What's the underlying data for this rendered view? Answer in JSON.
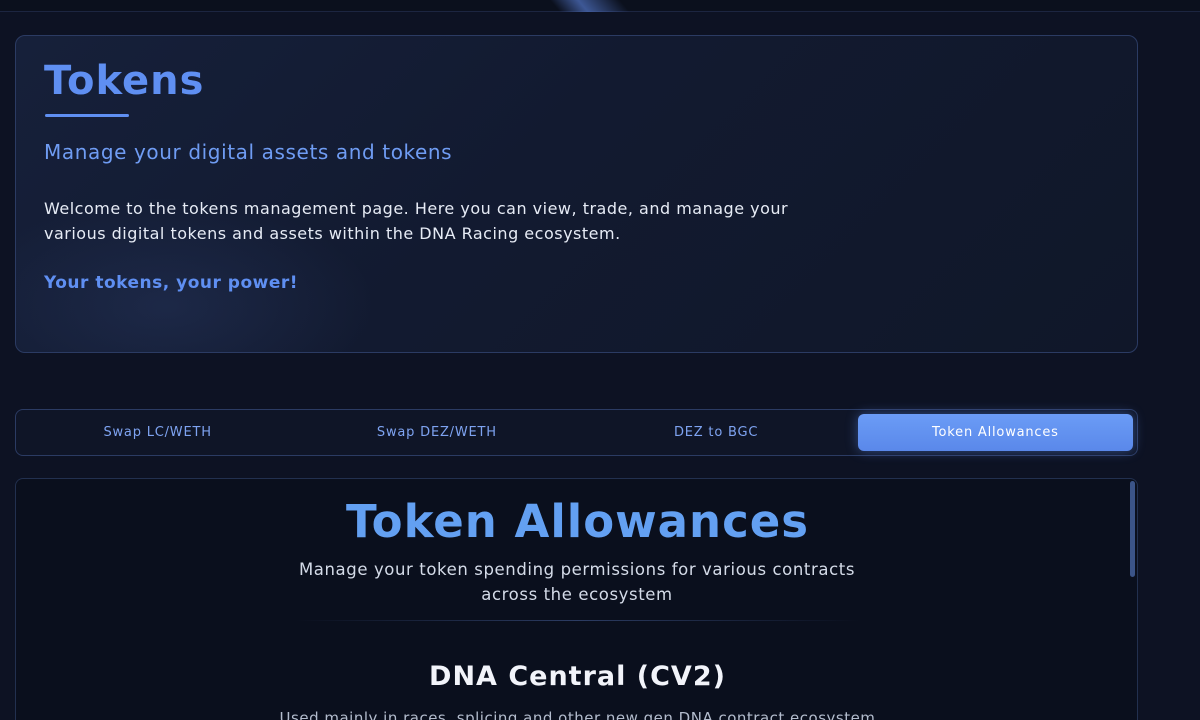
{
  "hero": {
    "title": "Tokens",
    "subtitle": "Manage your digital assets and tokens",
    "description": "Welcome to the tokens management page. Here you can view, trade, and manage your various digital tokens and assets within the DNA Racing ecosystem.",
    "tagline": "Your tokens, your power!"
  },
  "tabs": [
    {
      "label": "Swap LC/WETH",
      "active": false
    },
    {
      "label": "Swap DEZ/WETH",
      "active": false
    },
    {
      "label": "DEZ to BGC",
      "active": false
    },
    {
      "label": "Token Allowances",
      "active": true
    }
  ],
  "panel": {
    "title": "Token Allowances",
    "subtitle": "Manage your token spending permissions for various contracts across the ecosystem",
    "section": {
      "title": "DNA Central (CV2)",
      "description": "Used mainly in races, splicing and other new gen DNA contract ecosystem"
    }
  },
  "colors": {
    "accent": "#5f8ff2",
    "background": "#0d1223",
    "active_tab": "#6b9cf6"
  }
}
